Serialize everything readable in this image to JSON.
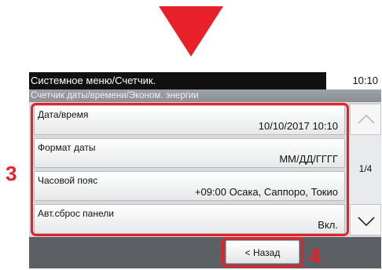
{
  "header": {
    "title": "Системное меню/Счетчик.",
    "time": "10:10"
  },
  "breadcrumb": "Счетчик даты/времени/Эконом. энергии",
  "items": [
    {
      "label": "Дата/время",
      "value": "10/10/2017 10:10"
    },
    {
      "label": "Формат даты",
      "value": "ММ/ДД/ГГГГ"
    },
    {
      "label": "Часовой пояс",
      "value": "+09:00 Осака, Саппоро, Токио"
    },
    {
      "label": "Авт.сброс панели",
      "value": "Вкл."
    }
  ],
  "pager": {
    "text": "1/4"
  },
  "footer": {
    "back_label": "< Назад"
  },
  "callouts": {
    "list": "3",
    "back": "4"
  },
  "colors": {
    "accent": "#e8202a",
    "title_bg": "#111111",
    "footer_bg": "#5c5f63"
  },
  "icons": {
    "down_arrow": "red-down-triangle",
    "scroll_up": "chevron-up-icon",
    "scroll_down": "chevron-down-icon"
  }
}
